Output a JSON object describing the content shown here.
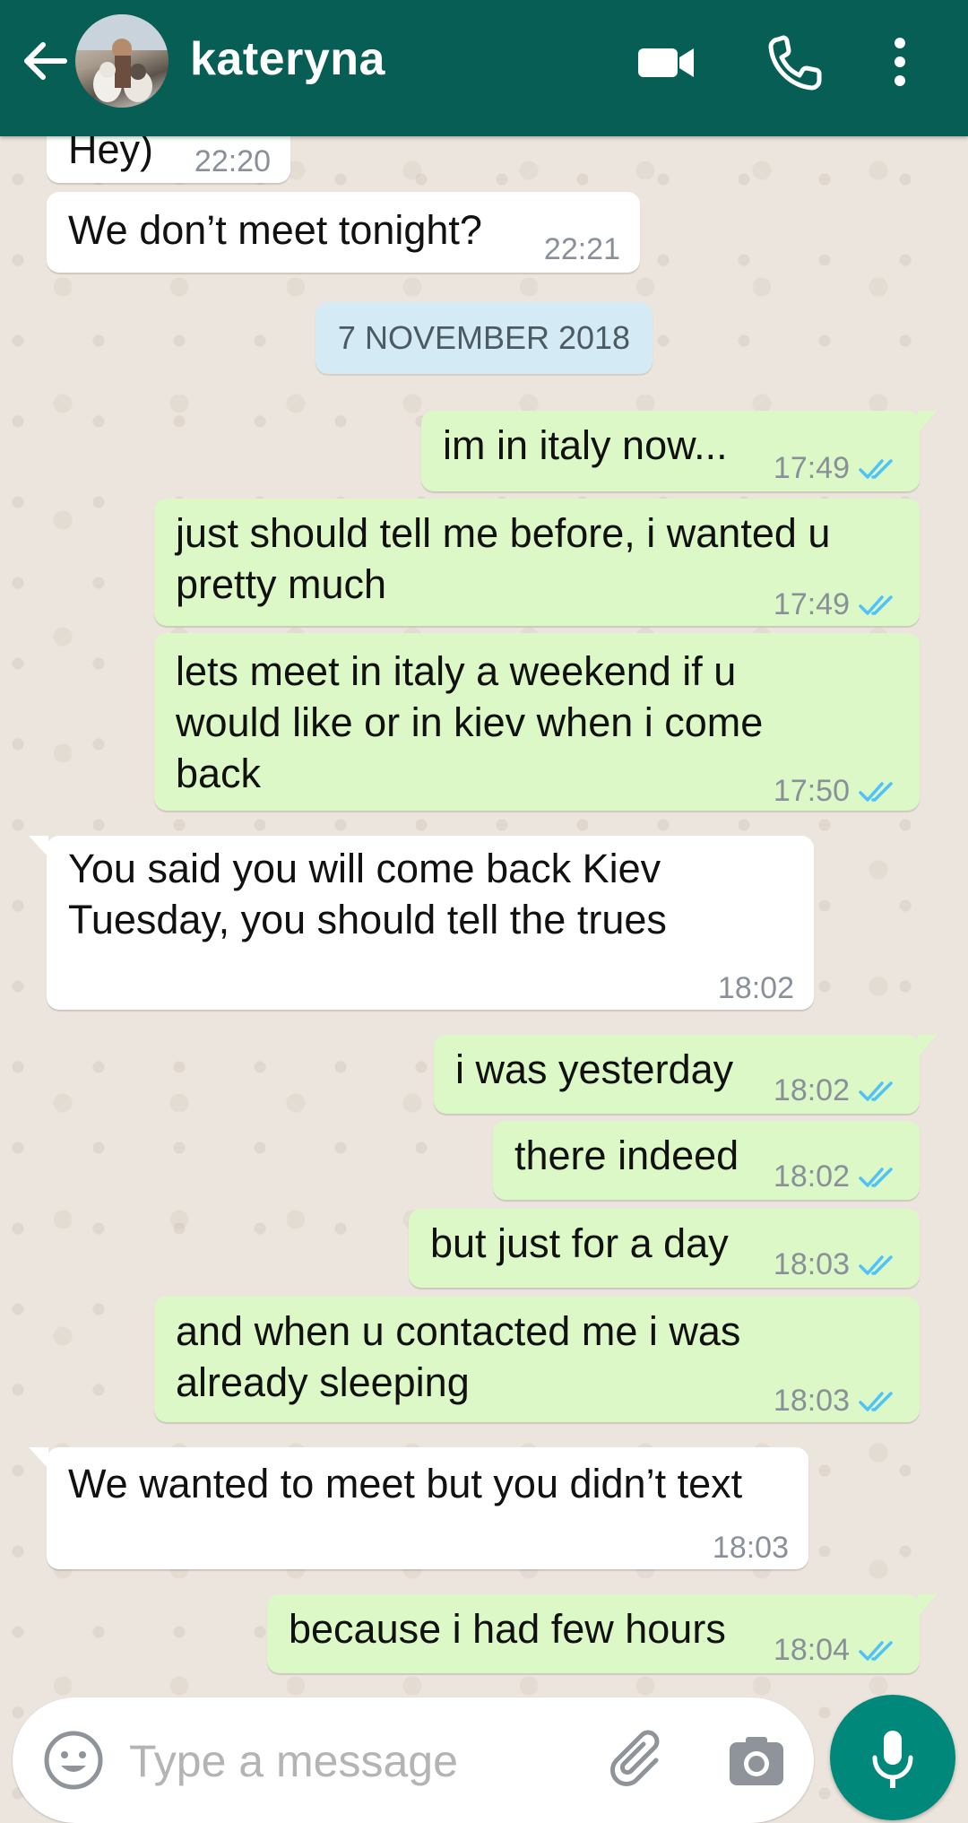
{
  "header": {
    "contact_name": "kateryna",
    "icons": [
      "back-arrow-icon",
      "avatar",
      "video-call-icon",
      "phone-icon",
      "more-options-icon"
    ]
  },
  "date_separator": "7 NOVEMBER 2018",
  "messages": [
    {
      "dir": "in",
      "text": "Hey)",
      "time": "22:20"
    },
    {
      "dir": "in",
      "text": "We don’t meet tonight?",
      "time": "22:21"
    },
    {
      "dir": "out",
      "text": "im in italy now...",
      "time": "17:49",
      "status": "read"
    },
    {
      "dir": "out",
      "lines": [
        "just should tell me before, i wanted u",
        "pretty much"
      ],
      "time": "17:49",
      "status": "read"
    },
    {
      "dir": "out",
      "lines": [
        "lets meet in italy a weekend if u",
        "would like or in kiev when i come",
        "back"
      ],
      "time": "17:50",
      "status": "read"
    },
    {
      "dir": "in",
      "lines": [
        "You said you will come back Kiev",
        "Tuesday, you should tell the trues"
      ],
      "time": "18:02"
    },
    {
      "dir": "out",
      "text": "i was yesterday",
      "time": "18:02",
      "status": "read"
    },
    {
      "dir": "out",
      "text": "there indeed",
      "time": "18:02",
      "status": "read"
    },
    {
      "dir": "out",
      "text": "but just for a day",
      "time": "18:03",
      "status": "read"
    },
    {
      "dir": "out",
      "lines": [
        "and when u contacted me i was",
        "already sleeping"
      ],
      "time": "18:03",
      "status": "read"
    },
    {
      "dir": "in",
      "text": "We wanted to meet but you didn’t text",
      "time": "18:03"
    },
    {
      "dir": "out",
      "text": "because i had few hours",
      "time": "18:04",
      "status": "read"
    }
  ],
  "composer": {
    "placeholder": "Type a message",
    "icons": [
      "emoji-icon",
      "attach-icon",
      "camera-icon",
      "mic-icon"
    ]
  },
  "colors": {
    "header": "#075e54",
    "outgoing_bubble": "#dcf8c6",
    "incoming_bubble": "#ffffff",
    "read_ticks": "#4fc3f7",
    "mic_button": "#00897b",
    "wallpaper": "#ece5dd"
  }
}
